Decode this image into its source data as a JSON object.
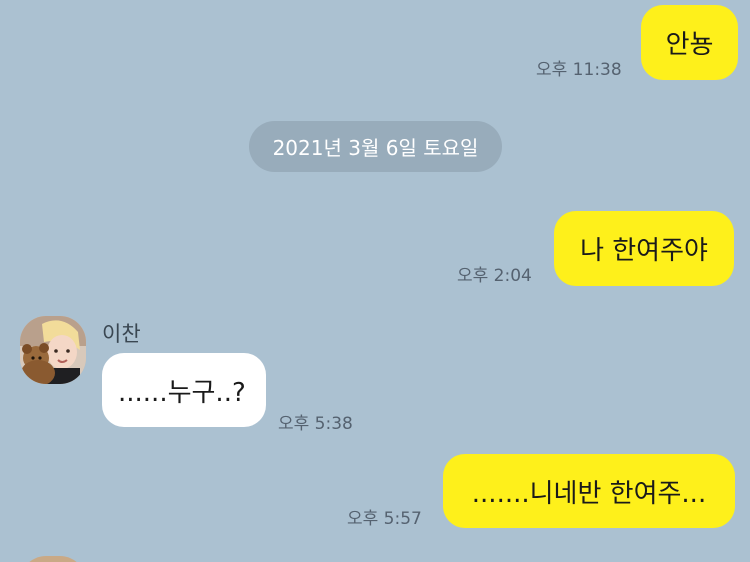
{
  "chat": {
    "messages": [
      {
        "text": "안뇽",
        "time": "오후 11:38"
      },
      {
        "text": "나 한여주야",
        "time": "오후 2:04"
      },
      {
        "sender": "이찬",
        "text": "......누구..?",
        "time": "오후 5:38"
      },
      {
        "text": ".......니네반 한여주...",
        "time": "오후 5:57"
      }
    ],
    "date_divider": "2021년 3월 6일 토요일"
  },
  "colors": {
    "background": "#abc1d1",
    "my_bubble": "#fef01b",
    "their_bubble": "#ffffff",
    "date_pill": "#98acbb"
  },
  "icons": {
    "avatar": "profile-avatar-icon"
  }
}
